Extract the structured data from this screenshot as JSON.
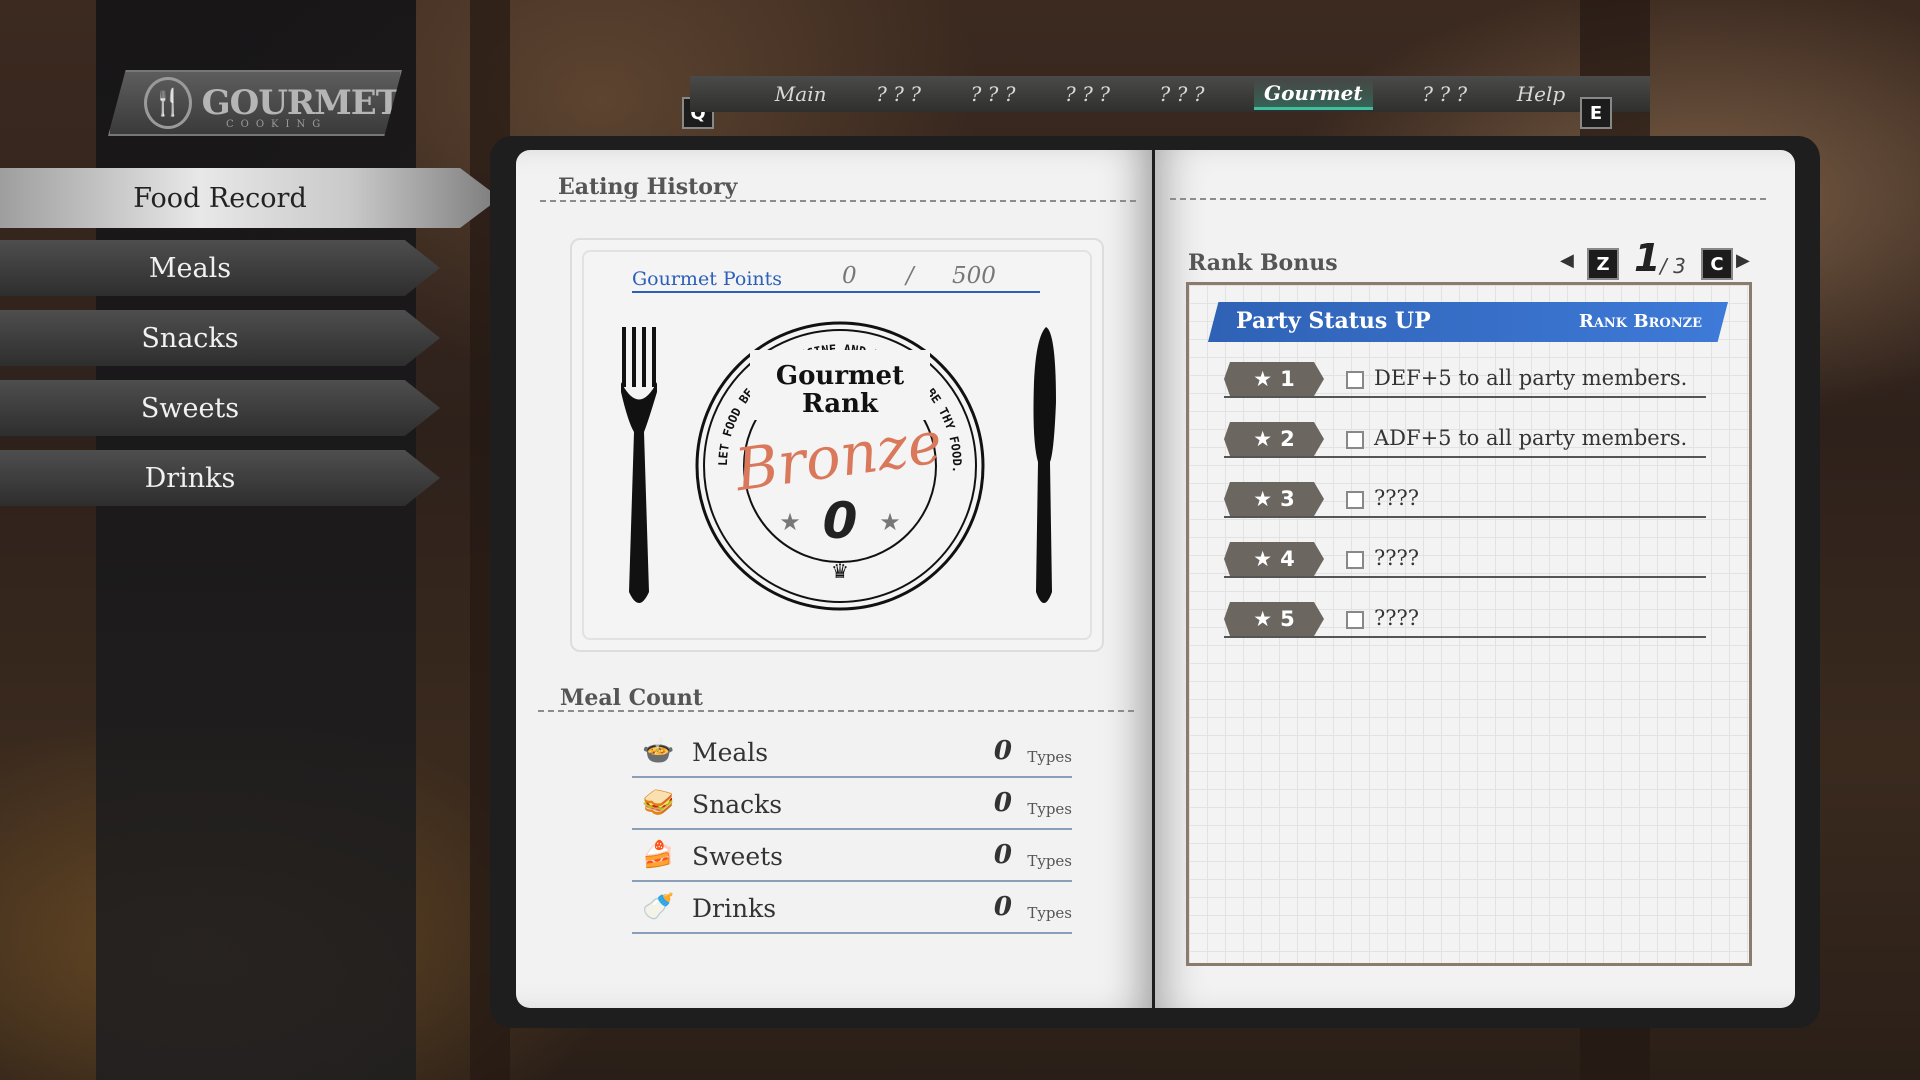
{
  "sidebar": {
    "logo_text": "GOURMET",
    "logo_sub": "COOKING",
    "items": [
      {
        "label": "Food Record"
      },
      {
        "label": "Meals"
      },
      {
        "label": "Snacks"
      },
      {
        "label": "Sweets"
      },
      {
        "label": "Drinks"
      }
    ]
  },
  "topbar": {
    "prev_key": "Q",
    "next_key": "E",
    "tabs": [
      {
        "label": "Main"
      },
      {
        "label": "? ? ?"
      },
      {
        "label": "? ? ?"
      },
      {
        "label": "? ? ?"
      },
      {
        "label": "? ? ?"
      },
      {
        "label": "Gourmet"
      },
      {
        "label": "? ? ?"
      },
      {
        "label": "Help"
      }
    ]
  },
  "eating_history": {
    "title": "Eating History",
    "points_label": "Gourmet Points",
    "points_value": "0",
    "points_sep": "/",
    "points_max": "500",
    "stamp": {
      "line1": "Gourmet",
      "line2": "Rank",
      "rank": "Bronze",
      "number": "0",
      "ring_text": "LET FOOD BE THY MEDICINE AND MEDICINE BE THY FOOD."
    }
  },
  "meal_count": {
    "title": "Meal Count",
    "unit": "Types",
    "rows": [
      {
        "label": "Meals",
        "value": "0",
        "icon": "meal-bowl-icon"
      },
      {
        "label": "Snacks",
        "value": "0",
        "icon": "sandwich-icon"
      },
      {
        "label": "Sweets",
        "value": "0",
        "icon": "cake-icon"
      },
      {
        "label": "Drinks",
        "value": "0",
        "icon": "bottle-icon"
      }
    ]
  },
  "rank_bonus": {
    "title": "Rank Bonus",
    "prev_key": "Z",
    "next_key": "C",
    "page": "1",
    "page_total": "/ 3",
    "banner_title": "Party Status UP",
    "banner_rank": "Rank Bronze",
    "rows": [
      {
        "star": "★",
        "num": "1",
        "text": "DEF+5 to all party members."
      },
      {
        "star": "★",
        "num": "2",
        "text": "ADF+5 to all party members."
      },
      {
        "star": "★",
        "num": "3",
        "text": "????"
      },
      {
        "star": "★",
        "num": "4",
        "text": "????"
      },
      {
        "star": "★",
        "num": "5",
        "text": "????"
      }
    ]
  },
  "colors": {
    "accent_blue": "#2f62b5",
    "active_tab": "#3fbfa0",
    "stamp_bronze": "#d9785a"
  }
}
